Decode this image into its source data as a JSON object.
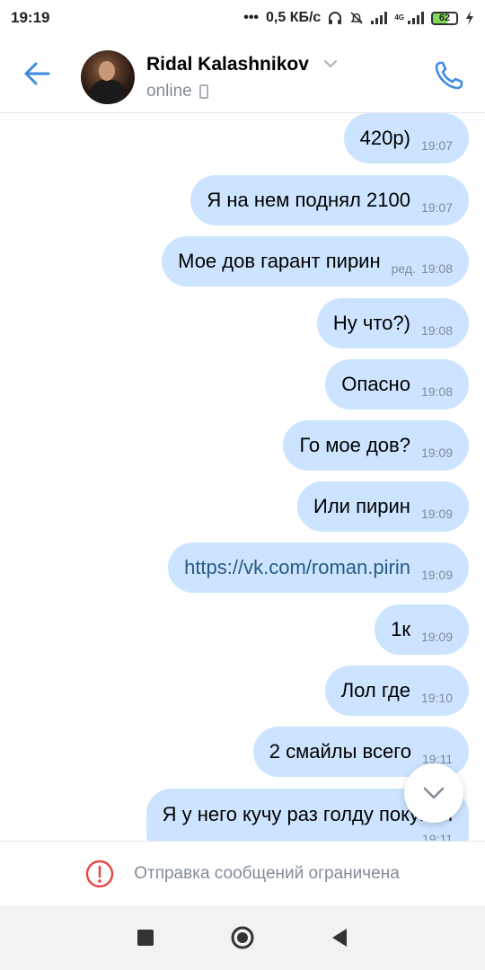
{
  "status_bar": {
    "time": "19:19",
    "network_speed": "0,5 КБ/с",
    "network_type": "4G",
    "battery": "62",
    "icons": [
      "dots-icon",
      "headphones-icon",
      "mute-icon",
      "signal-icon",
      "battery-icon",
      "charging-icon"
    ]
  },
  "header": {
    "contact_name": "Ridal Kalashnikov",
    "status": "online",
    "icons": [
      "back-arrow-icon",
      "chevron-down-icon",
      "mobile-icon",
      "phone-call-icon"
    ],
    "accent_color": "#3f8ae0"
  },
  "messages": [
    {
      "text": "420р)",
      "time": "19:07"
    },
    {
      "text": "Я на нем поднял 2100",
      "time": "19:07"
    },
    {
      "text": "Мое дов гарант пирин",
      "edited": "ред.",
      "time": "19:08"
    },
    {
      "text": "Ну что?)",
      "time": "19:08"
    },
    {
      "text": "Опасно",
      "time": "19:08"
    },
    {
      "text": "Го мое дов?",
      "time": "19:09"
    },
    {
      "text": "Или пирин",
      "time": "19:09"
    },
    {
      "text": "https://vk.com/roman.pirin",
      "time": "19:09",
      "is_link": true
    },
    {
      "text": "1к",
      "time": "19:09"
    },
    {
      "text": "Лол где",
      "time": "19:10"
    },
    {
      "text": "2 смайлы всего",
      "time": "19:11"
    },
    {
      "text": "Я у него кучу раз голду покупал",
      "time": "19:11"
    }
  ],
  "bubble_color": "#cce4ff",
  "restriction": {
    "message": "Отправка сообщений ограничена",
    "icon": "alert-circle-icon",
    "icon_color": "#e64646"
  },
  "navbar": {
    "icons": [
      "recents-square-icon",
      "home-circle-icon",
      "back-triangle-icon"
    ]
  }
}
